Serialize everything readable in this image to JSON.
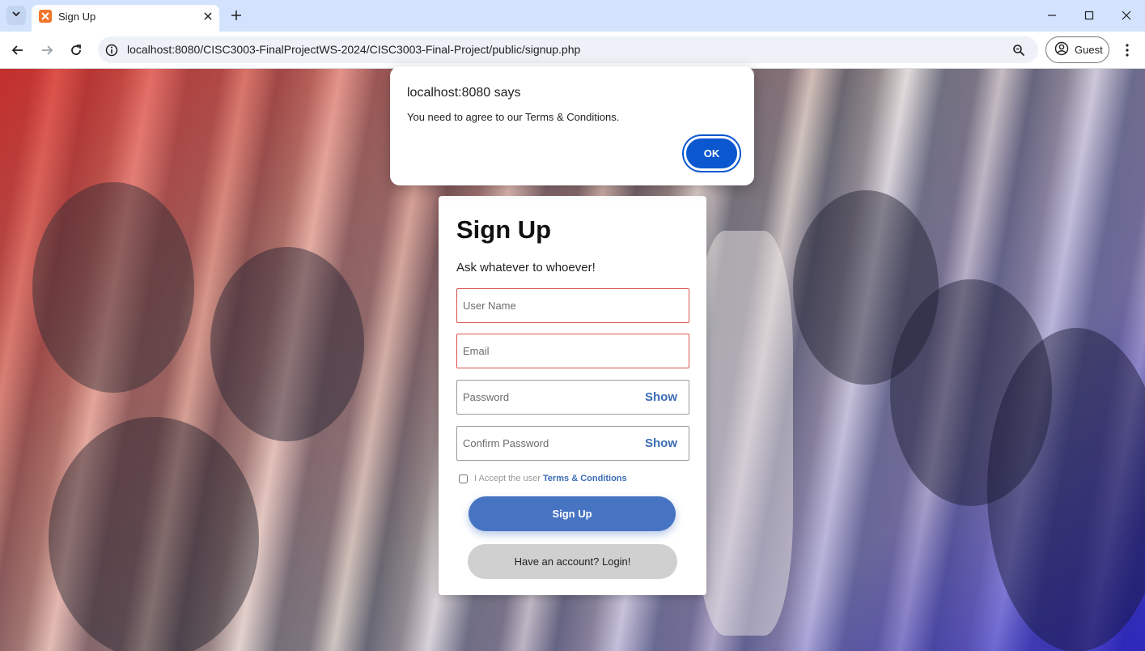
{
  "browser": {
    "tab_title": "Sign Up",
    "url": "localhost:8080/CISC3003-FinalProjectWS-2024/CISC3003-Final-Project/public/signup.php",
    "profile_label": "Guest"
  },
  "dialog": {
    "title": "localhost:8080 says",
    "message": "You need to agree to our Terms & Conditions.",
    "ok_label": "OK"
  },
  "signup": {
    "title": "Sign Up",
    "subtitle": "Ask whatever to whoever!",
    "username_placeholder": "User Name",
    "email_placeholder": "Email",
    "password_placeholder": "Password",
    "confirm_placeholder": "Confirm Password",
    "show_label": "Show",
    "terms_prefix": "I Accept the user",
    "terms_link": "Terms & Conditions",
    "signup_label": "Sign Up",
    "login_label": "Have an account? Login!"
  },
  "colors": {
    "accent": "#4674c2",
    "link": "#3b6db5",
    "invalid_border": "#d9534f",
    "dialog_button": "#0b57d0",
    "tabbar": "#d3e3fd"
  }
}
